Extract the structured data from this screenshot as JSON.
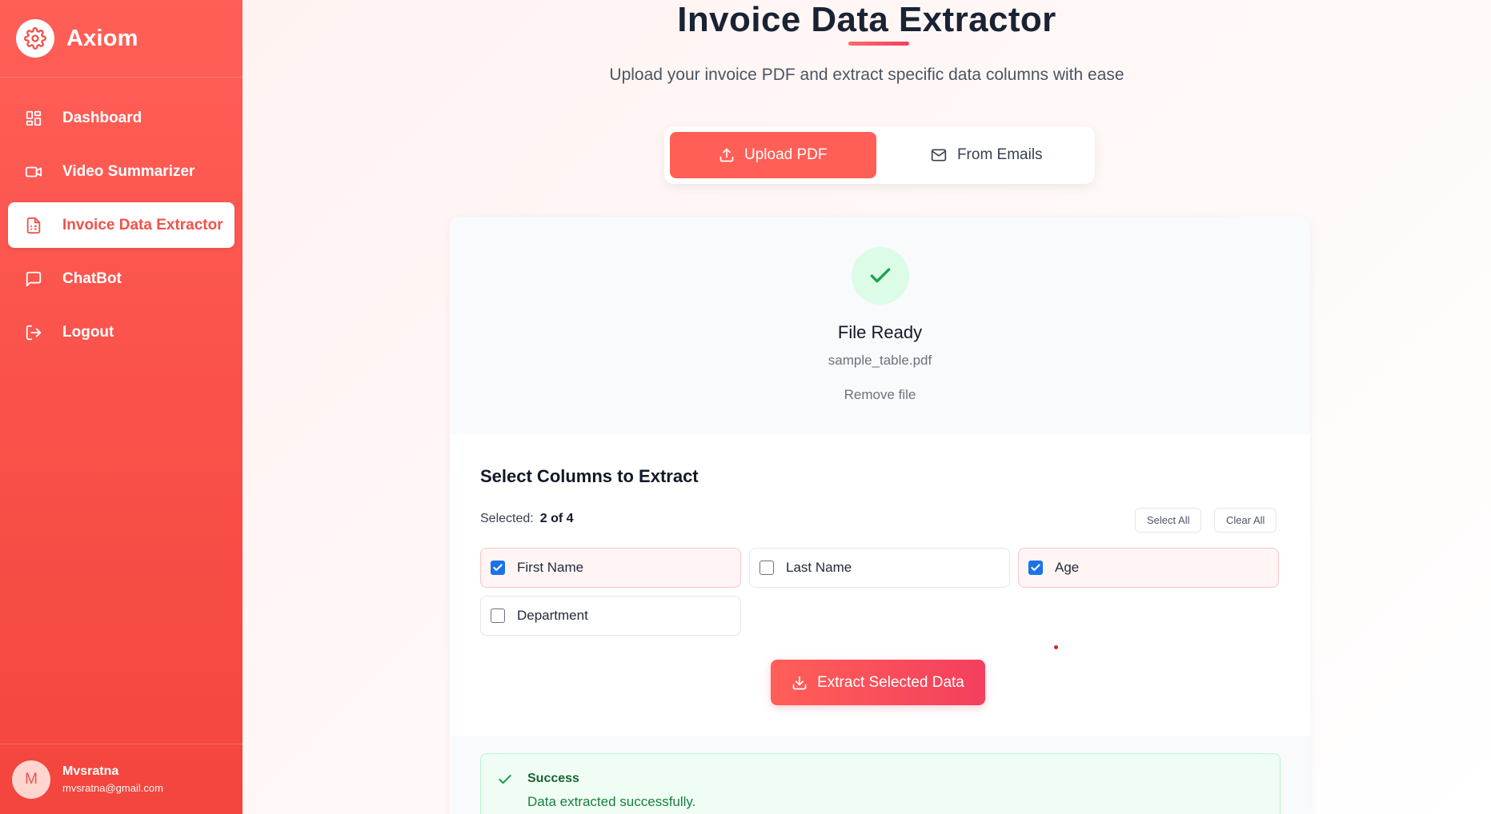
{
  "brand": {
    "name": "Axiom"
  },
  "nav": [
    {
      "label": "Dashboard",
      "icon": "dashboard-icon",
      "active": false
    },
    {
      "label": "Video Summarizer",
      "icon": "video-icon",
      "active": false
    },
    {
      "label": "Invoice Data Extractor",
      "icon": "document-icon",
      "active": true
    },
    {
      "label": "ChatBot",
      "icon": "chat-icon",
      "active": false
    },
    {
      "label": "Logout",
      "icon": "logout-icon",
      "active": false
    }
  ],
  "user": {
    "initial": "M",
    "name": "Mvsratna",
    "email": "mvsratna@gmail.com"
  },
  "page": {
    "title": "Invoice Data Extractor",
    "subtitle": "Upload your invoice PDF and extract specific data columns with ease"
  },
  "modes": {
    "upload_label": "Upload PDF",
    "emails_label": "From Emails",
    "active": "upload"
  },
  "file": {
    "status": "File Ready",
    "name": "sample_table.pdf",
    "remove_label": "Remove file"
  },
  "columns": {
    "title": "Select Columns to Extract",
    "selected_label": "Selected:",
    "selected_count": "2 of 4",
    "select_all_label": "Select All",
    "clear_all_label": "Clear All",
    "options": [
      {
        "label": "First Name",
        "checked": true
      },
      {
        "label": "Last Name",
        "checked": false
      },
      {
        "label": "Age",
        "checked": true
      },
      {
        "label": "Department",
        "checked": false
      }
    ]
  },
  "extract": {
    "label": "Extract Selected Data"
  },
  "result": {
    "title": "Success",
    "message": "Data extracted successfully."
  },
  "colors": {
    "accent": "#ff5f57",
    "sidebar": "#f95049",
    "success": "#166534",
    "checkbox": "#1a73e8"
  }
}
